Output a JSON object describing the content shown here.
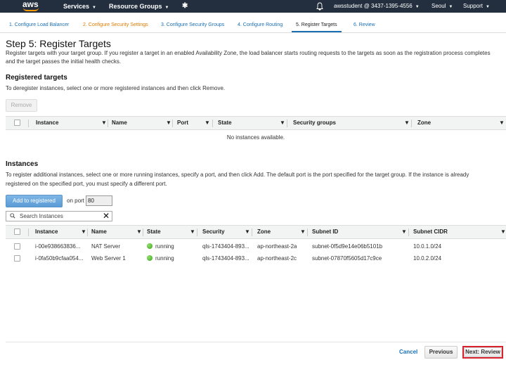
{
  "topnav": {
    "logo": "aws",
    "services": "Services",
    "resource_groups": "Resource Groups",
    "pin_icon": "pin-icon",
    "bell_icon": "bell-icon",
    "account": "awsstudent @ 3437-1395-4556",
    "region": "Seoul",
    "support": "Support"
  },
  "wizard_tabs": [
    {
      "label": "1. Configure Load Balancer"
    },
    {
      "label": "2. Configure Security Settings"
    },
    {
      "label": "3. Configure Security Groups"
    },
    {
      "label": "4. Configure Routing"
    },
    {
      "label": "5. Register Targets"
    },
    {
      "label": "6. Review"
    }
  ],
  "page": {
    "title": "Step 5: Register Targets",
    "desc_line1": "Register targets with your target group. If you register a target in an enabled Availability Zone, the load balancer starts routing requests to the targets as soon as the registration process completes",
    "desc_line2": "and the target passes the initial health checks."
  },
  "registered": {
    "title": "Registered targets",
    "desc": "To deregister instances, select one or more registered instances and then click Remove.",
    "remove_button": "Remove",
    "columns": [
      "Instance",
      "Name",
      "Port",
      "State",
      "Security groups",
      "Zone"
    ],
    "empty_message": "No instances available."
  },
  "instances": {
    "title": "Instances",
    "desc_line1": "To register additional instances, select one or more running instances, specify a port, and then click Add. The default port is the port specified for the target group. If the instance is already",
    "desc_line2": "registered on the specified port, you must specify a different port.",
    "add_button": "Add to registered",
    "port_label": "on port",
    "port_value": "80",
    "search_placeholder": "Search Instances",
    "columns": [
      "Instance",
      "Name",
      "State",
      "Security",
      "Zone",
      "Subnet ID",
      "Subnet CIDR"
    ],
    "rows": [
      {
        "instance": "i-00e938663836...",
        "name": "NAT Server",
        "state": "running",
        "security": "qls-1743404-893...",
        "zone": "ap-northeast-2a",
        "subnet_id": "subnet-0f5d9e14e06b5101b",
        "subnet_cidr": "10.0.1.0/24"
      },
      {
        "instance": "i-0fa50b9cfaa054...",
        "name": "Web Server 1",
        "state": "running",
        "security": "qls-1743404-893...",
        "zone": "ap-northeast-2c",
        "subnet_id": "subnet-07870f5605d17c9ce",
        "subnet_cidr": "10.0.2.0/24"
      }
    ]
  },
  "footer": {
    "cancel": "Cancel",
    "previous": "Previous",
    "next": "Next: Review"
  },
  "colors": {
    "nav_bg": "#232f3e",
    "aws_orange": "#ff9900",
    "link_blue": "#1a6fb3",
    "tab_orange": "#e07b00",
    "running_green": "#3aa31a",
    "highlight_red": "#d9232e"
  }
}
